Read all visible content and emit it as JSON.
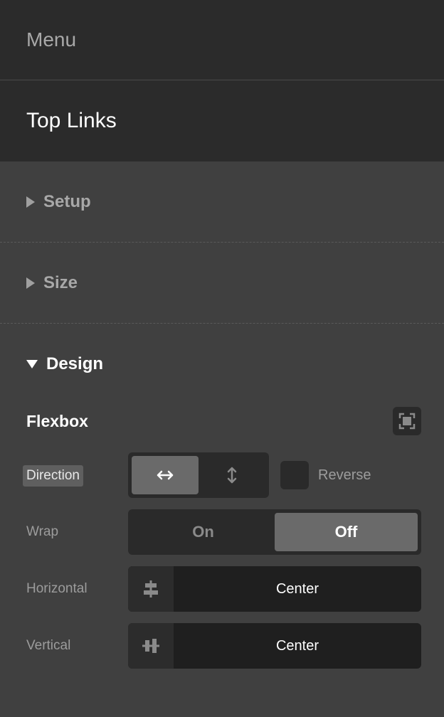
{
  "topbar": {
    "title": "Menu"
  },
  "element": {
    "name": "Top Links"
  },
  "sections": {
    "setup": "Setup",
    "size": "Size",
    "design": "Design"
  },
  "design": {
    "group_title": "Flexbox",
    "direction": {
      "label": "Direction",
      "options": [
        "horizontal",
        "vertical"
      ],
      "selected": "horizontal",
      "reverse_label": "Reverse",
      "reverse_checked": false
    },
    "wrap": {
      "label": "Wrap",
      "on_label": "On",
      "off_label": "Off",
      "selected": "Off"
    },
    "horizontal": {
      "label": "Horizontal",
      "value": "Center",
      "icon": "align-horizontal-center-icon"
    },
    "vertical": {
      "label": "Vertical",
      "value": "Center",
      "icon": "align-vertical-center-icon"
    }
  },
  "colors": {
    "panel_bg": "#404040",
    "header_bg": "#2b2b2b",
    "control_bg": "#2a2a2a",
    "active_bg": "#6a6a6a"
  }
}
